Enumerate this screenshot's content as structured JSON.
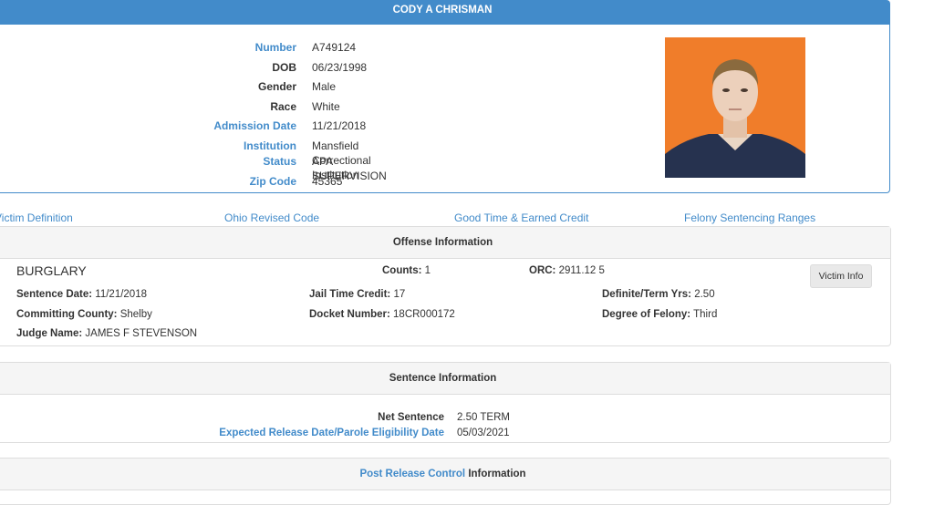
{
  "header": {
    "name": "CODY A CHRISMAN"
  },
  "details": [
    {
      "label": "Number",
      "value": "A749124",
      "link": true
    },
    {
      "label": "DOB",
      "value": "06/23/1998",
      "link": false
    },
    {
      "label": "Gender",
      "value": "Male",
      "link": false
    },
    {
      "label": "Race",
      "value": "White",
      "link": false
    },
    {
      "label": "Admission Date",
      "value": "11/21/2018",
      "link": true
    },
    {
      "label": "Institution",
      "value": "Mansfield Correctional Institution",
      "link": true
    },
    {
      "label": "Status",
      "value": "APA SUPERVISION",
      "link": true
    },
    {
      "label": "Zip Code",
      "value": "45365",
      "link": true
    }
  ],
  "links": {
    "victim_definition": "Victim Definition",
    "ohio_revised_code": "Ohio Revised Code",
    "good_time": "Good Time & Earned Credit",
    "felony_ranges": "Felony Sentencing Ranges"
  },
  "offense": {
    "title": "Offense Information",
    "offense_name": "BURGLARY",
    "counts_label": "Counts:",
    "counts_value": "1",
    "orc_label": "ORC:",
    "orc_value": "2911.12 5",
    "victim_info_button": "Victim Info",
    "sentence_date_label": "Sentence Date:",
    "sentence_date_value": "11/21/2018",
    "jail_credit_label": "Jail Time Credit:",
    "jail_credit_value": "17",
    "term_label": "Definite/Term Yrs:",
    "term_value": "2.50",
    "county_label": "Committing County:",
    "county_value": "Shelby",
    "docket_label": "Docket Number:",
    "docket_value": "18CR000172",
    "degree_label": "Degree of Felony:",
    "degree_value": "Third",
    "judge_label": "Judge Name:",
    "judge_value": "JAMES F STEVENSON"
  },
  "sentence": {
    "title": "Sentence Information",
    "net_label": "Net Sentence",
    "net_value": "2.50 TERM",
    "release_label": "Expected Release Date/Parole Eligibility Date",
    "release_value": "05/03/2021"
  },
  "post_release": {
    "title_link": "Post Release Control",
    "title_rest": "Information"
  }
}
